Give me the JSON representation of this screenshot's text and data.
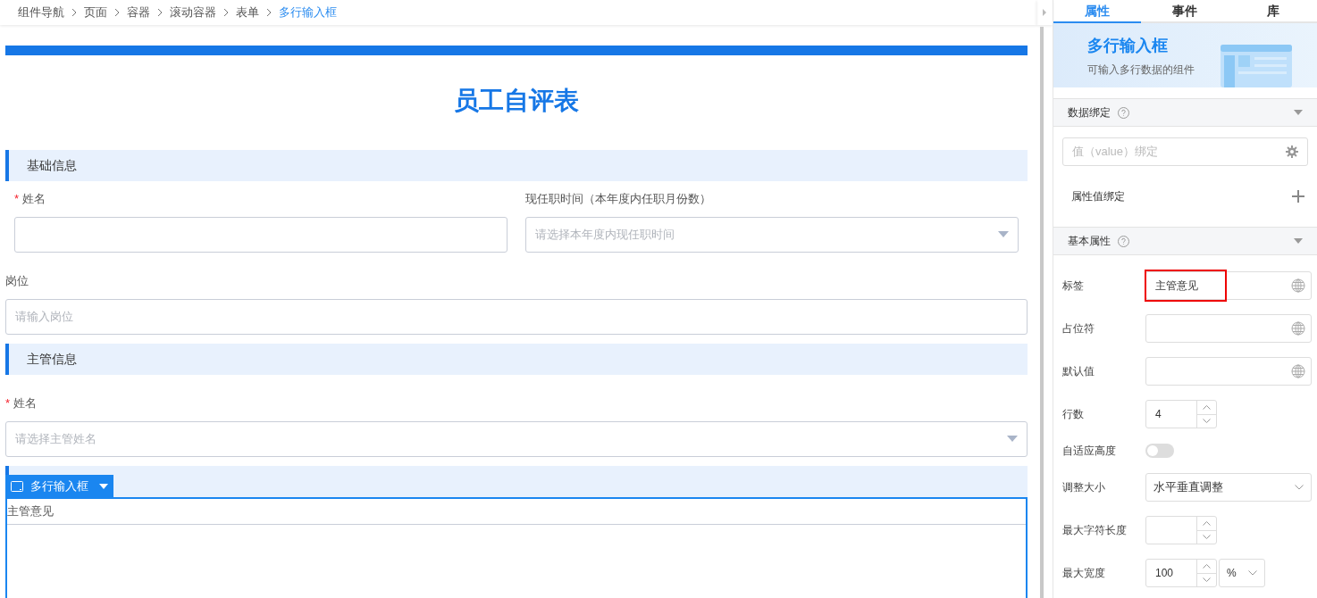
{
  "breadcrumb": [
    {
      "label": "组件导航",
      "current": false
    },
    {
      "label": "页面",
      "current": false
    },
    {
      "label": "容器",
      "current": false
    },
    {
      "label": "滚动容器",
      "current": false
    },
    {
      "label": "表单",
      "current": false
    },
    {
      "label": "多行输入框",
      "current": true
    }
  ],
  "form": {
    "title": "员工自评表",
    "blocks": [
      {
        "kind": "section",
        "title": "基础信息"
      },
      {
        "kind": "row",
        "fields": [
          {
            "kind": "input",
            "required_mark": "*",
            "label": "姓名"
          },
          {
            "kind": "select",
            "label": "现任职时间（本年度内任职月份数）",
            "placeholder": "请选择本年度内现任职时间"
          }
        ]
      },
      {
        "kind": "input-field",
        "label": "岗位",
        "placeholder": "请输入岗位"
      },
      {
        "kind": "section",
        "title": "主管信息"
      },
      {
        "kind": "select-field",
        "required_mark": "*",
        "label": "姓名",
        "placeholder": "请选择主管姓名"
      },
      {
        "kind": "section",
        "selected_component": "多行输入框"
      },
      {
        "kind": "textarea",
        "label": "主管意见",
        "selected": true
      }
    ]
  },
  "panel": {
    "tabs": [
      {
        "label": "属性",
        "selected": true
      },
      {
        "label": "事件",
        "selected": false
      },
      {
        "label": "库",
        "selected": false
      }
    ],
    "banner": {
      "title": "多行输入框",
      "subtitle": "可输入多行数据的组件"
    },
    "data_binding": {
      "title": "数据绑定",
      "expanded": true,
      "value_placeholder": "值（value）绑定",
      "property_binding": "属性值绑定"
    },
    "basic": {
      "title": "基本属性",
      "expanded": true,
      "props": [
        {
          "kind": "text",
          "label": "标签",
          "value": "主管意见",
          "highlighted": true
        },
        {
          "kind": "text",
          "label": "占位符",
          "highlighted": false
        },
        {
          "kind": "text",
          "label": "默认值",
          "highlighted": false
        },
        {
          "kind": "number",
          "label": "行数",
          "value": "4"
        },
        {
          "kind": "switch",
          "label": "自适应高度",
          "on": false
        },
        {
          "kind": "select",
          "label": "调整大小",
          "value": "水平垂直调整"
        },
        {
          "kind": "number",
          "label": "最大字符长度"
        },
        {
          "kind": "number-unit",
          "label": "最大宽度",
          "value": "100",
          "unit": "%"
        }
      ]
    }
  }
}
